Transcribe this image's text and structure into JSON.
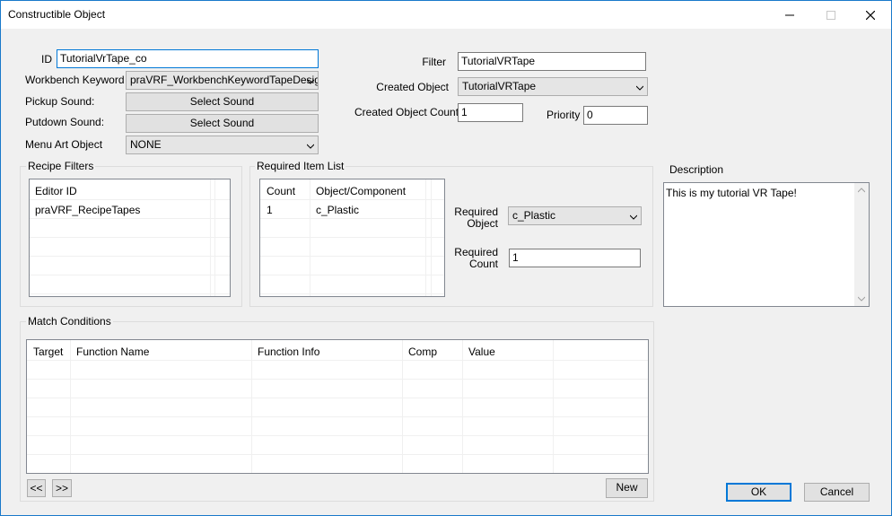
{
  "window": {
    "title": "Constructible Object",
    "controls": [
      "minimize-icon",
      "maximize-icon",
      "close-icon"
    ]
  },
  "fields": {
    "id_label": "ID",
    "id_value": "TutorialVrTape_co",
    "workbench_label": "Workbench Keyword",
    "workbench_value": "praVRF_WorkbenchKeywordTapeDesig",
    "pickup_label": "Pickup Sound:",
    "pickup_button": "Select Sound",
    "putdown_label": "Putdown Sound:",
    "putdown_button": "Select Sound",
    "menuart_label": "Menu Art Object",
    "menuart_value": "NONE",
    "filter_label": "Filter",
    "filter_value": "TutorialVRTape",
    "created_object_label": "Created Object",
    "created_object_value": "TutorialVRTape",
    "created_count_label": "Created Object Count",
    "created_count_value": "1",
    "priority_label": "Priority",
    "priority_value": "0"
  },
  "recipe_filters": {
    "title": "Recipe Filters",
    "columns": [
      "Editor ID"
    ],
    "rows": [
      [
        "praVRF_RecipeTapes"
      ]
    ]
  },
  "required_items": {
    "title": "Required Item List",
    "columns": [
      "Count",
      "Object/Component"
    ],
    "rows": [
      [
        "1",
        "c_Plastic"
      ]
    ],
    "required_object_label_1": "Required",
    "required_object_label_2": "Object",
    "required_object_value": "c_Plastic",
    "required_count_label_1": "Required",
    "required_count_label_2": "Count",
    "required_count_value": "1"
  },
  "description": {
    "title": "Description",
    "text": "This is my tutorial VR Tape!"
  },
  "match_conditions": {
    "title": "Match Conditions",
    "columns": [
      "Target",
      "Function Name",
      "Function Info",
      "Comp",
      "Value"
    ],
    "prev_button": "<<",
    "next_button": ">>",
    "new_button": "New"
  },
  "footer": {
    "ok_button": "OK",
    "cancel_button": "Cancel"
  }
}
